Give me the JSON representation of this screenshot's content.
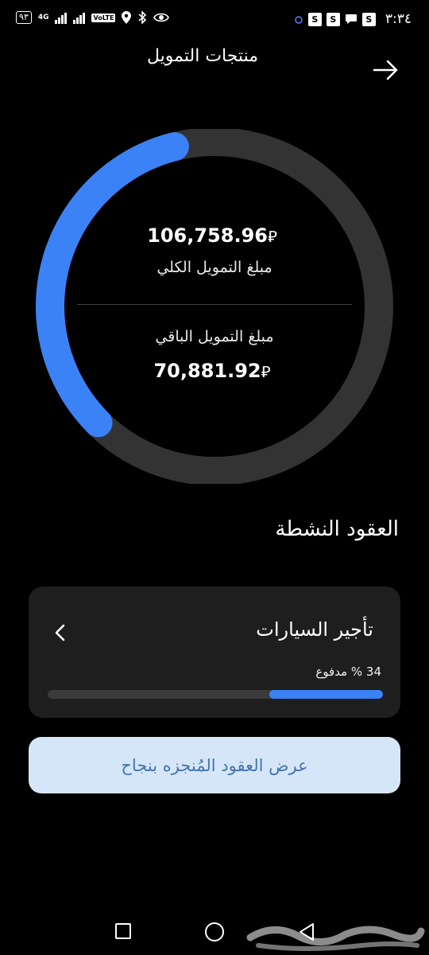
{
  "status_bar": {
    "battery": "٩٣",
    "network": "4G",
    "volte": "VoLTE",
    "right_icons": [
      "S",
      "S",
      "S"
    ],
    "time": "٣:٣٤"
  },
  "header": {
    "title": "منتجات التمويل",
    "back_icon": "arrow-right-icon"
  },
  "summary": {
    "total_amount": "106,758.96",
    "total_label": "مبلغ التمويل الكلي",
    "remaining_amount": "70,881.92",
    "remaining_label": "مبلغ التمويل الباقي",
    "currency_symbol": "⃁",
    "paid_fraction": 0.336,
    "ring_color": "#3b82f6",
    "track_color": "#333333"
  },
  "active_contracts": {
    "title": "العقود النشطة",
    "items": [
      {
        "name": "تأجير السيارات",
        "paid_text": "34 % مدفوع",
        "paid_fraction": 0.34
      }
    ]
  },
  "completed_button": {
    "label": "عرض العقود المُنجزه بنجاح"
  },
  "nav": {
    "icons": [
      "recents-icon",
      "home-icon",
      "back-icon"
    ]
  },
  "watermark": {
    "text": "حراج"
  }
}
